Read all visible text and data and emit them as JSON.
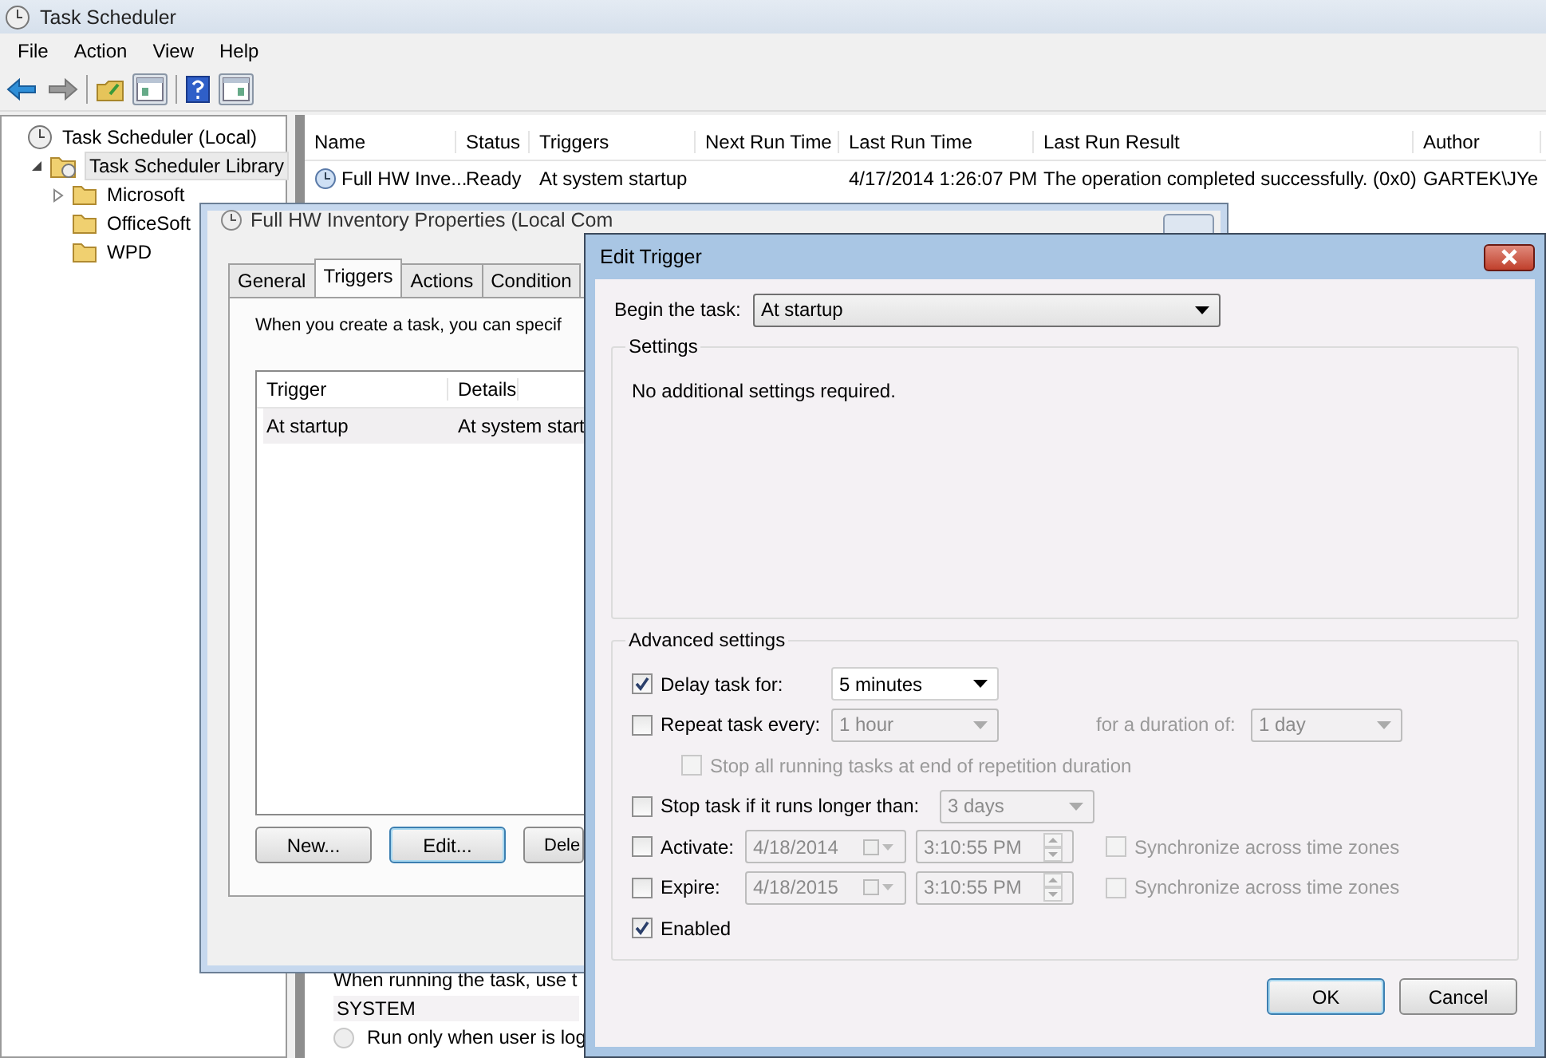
{
  "window": {
    "title": "Task Scheduler"
  },
  "menu": [
    "File",
    "Action",
    "View",
    "Help"
  ],
  "tree": [
    {
      "label": "Task Scheduler (Local)",
      "kind": "root",
      "selected": false,
      "children": [
        {
          "label": "Task Scheduler Library",
          "kind": "library",
          "expanded": true,
          "selected": true,
          "children": [
            {
              "label": "Microsoft",
              "kind": "folder",
              "expanded": false,
              "selected": false
            },
            {
              "label": "OfficeSoft",
              "kind": "folder",
              "selected": false
            },
            {
              "label": "WPD",
              "kind": "folder",
              "selected": false
            }
          ]
        }
      ]
    }
  ],
  "task_table": {
    "columns": [
      "Name",
      "Status",
      "Triggers",
      "Next Run Time",
      "Last Run Time",
      "Last Run Result",
      "Author"
    ],
    "rows": [
      {
        "name": "Full HW Inve...",
        "status": "Ready",
        "triggers": "At system startup",
        "last_run_time": "4/17/2014 1:26:07 PM",
        "last_run_result": "The operation completed successfully. (0x0)",
        "author": "GARTEK\\JYe"
      }
    ]
  },
  "general_pane": {
    "account_label": "When running the task, use t",
    "account": "SYSTEM",
    "options": [
      {
        "label": "Run only when user is log",
        "selected": false
      }
    ]
  },
  "properties_dialog": {
    "title": "Full HW Inventory Properties (Local Com",
    "tabs": [
      {
        "label": "General",
        "selected": false
      },
      {
        "label": "Triggers",
        "selected": true
      },
      {
        "label": "Actions",
        "selected": false
      },
      {
        "label": "Condition",
        "selected": false
      }
    ],
    "description": "When you create a task, you can specif",
    "columns": [
      "Trigger",
      "Details"
    ],
    "rows": [
      {
        "trigger": "At startup",
        "details": "At system start",
        "selected": true
      }
    ],
    "buttons": [
      {
        "label": "New...",
        "default": false
      },
      {
        "label": "Edit...",
        "default": true
      },
      {
        "label": "Dele",
        "default": false
      }
    ]
  },
  "edit_trigger": {
    "title": "Edit Trigger",
    "begin_label": "Begin the task:",
    "begin_value": "At startup",
    "settings_title": "Settings",
    "settings_note": "No additional settings required.",
    "advanced_title": "Advanced settings",
    "delay": {
      "label": "Delay task for:",
      "checked": true,
      "value": "5 minutes"
    },
    "repeat": {
      "label": "Repeat task every:",
      "checked": false,
      "value": "1 hour",
      "duration_label": "for a duration of:",
      "duration_value": "1 day"
    },
    "stop_all": {
      "label": "Stop all running tasks at end of repetition duration",
      "checked": false,
      "disabled": true
    },
    "stop_if": {
      "label": "Stop task if it runs longer than:",
      "checked": false,
      "value": "3 days"
    },
    "activate": {
      "label": "Activate:",
      "checked": false,
      "date": "4/18/2014",
      "time": "3:10:55 PM",
      "sync_label": "Synchronize across time zones",
      "sync_checked": false
    },
    "expire": {
      "label": "Expire:",
      "checked": false,
      "date": "4/18/2015",
      "time": "3:10:55 PM",
      "sync_label": "Synchronize across time zones",
      "sync_checked": false
    },
    "enabled": {
      "label": "Enabled",
      "checked": true
    },
    "buttons": [
      {
        "label": "OK",
        "default": true
      },
      {
        "label": "Cancel",
        "default": false
      }
    ]
  }
}
